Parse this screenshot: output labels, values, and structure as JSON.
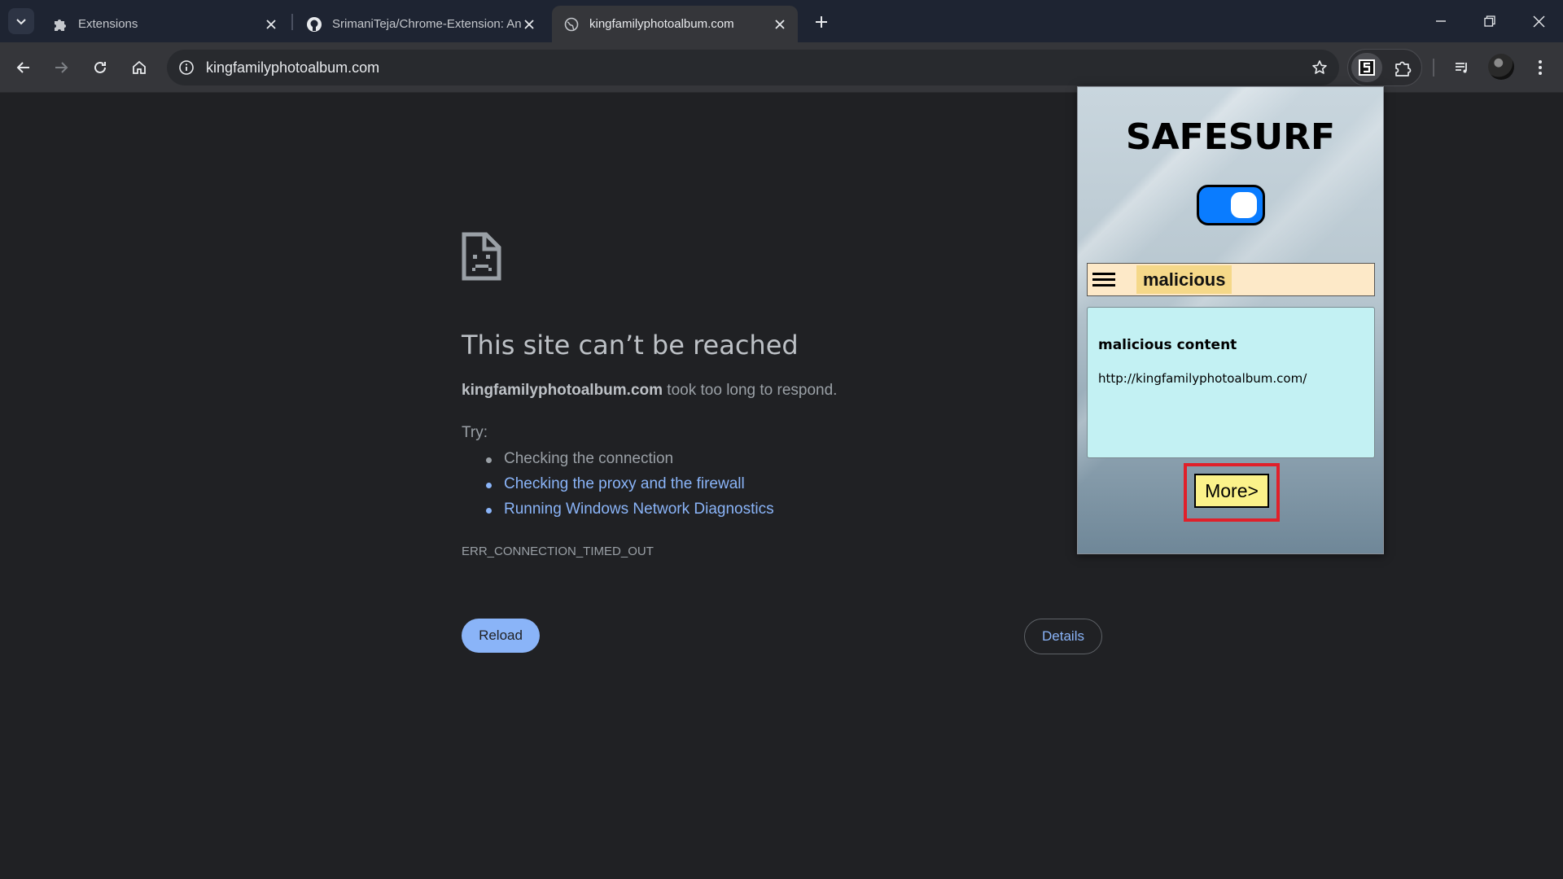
{
  "browser": {
    "tabs": [
      {
        "title": "Extensions",
        "favicon": "puzzle-icon",
        "active": false
      },
      {
        "title": "SrimaniTeja/Chrome-Extension: An",
        "favicon": "github-icon",
        "active": false
      },
      {
        "title": "kingfamilyphotoalbum.com",
        "favicon": "globe-icon",
        "active": true
      }
    ],
    "address_bar": {
      "url": "kingfamilyphotoalbum.com"
    }
  },
  "error_page": {
    "title": "This site can’t be reached",
    "host": "kingfamilyphotoalbum.com",
    "message": " took too long to respond.",
    "try_label": "Try:",
    "suggestions": [
      {
        "text": "Checking the connection",
        "link": false
      },
      {
        "text": "Checking the proxy and the firewall",
        "link": true
      },
      {
        "text": "Running Windows Network Diagnostics",
        "link": true
      }
    ],
    "error_code": "ERR_CONNECTION_TIMED_OUT",
    "reload_label": "Reload",
    "details_label": "Details"
  },
  "extension_popup": {
    "title": "SAFESURF",
    "toggle_on": true,
    "status_label": "malicious",
    "card_heading": "malicious content",
    "card_url": "http://kingfamilyphotoalbum.com/",
    "more_label": "More>",
    "colors": {
      "toggle": "#0a7cff",
      "status_bar": "#fde9c8",
      "card": "#c3f1f3",
      "more_button": "#fbf28a",
      "highlight": "#e0202a"
    }
  }
}
